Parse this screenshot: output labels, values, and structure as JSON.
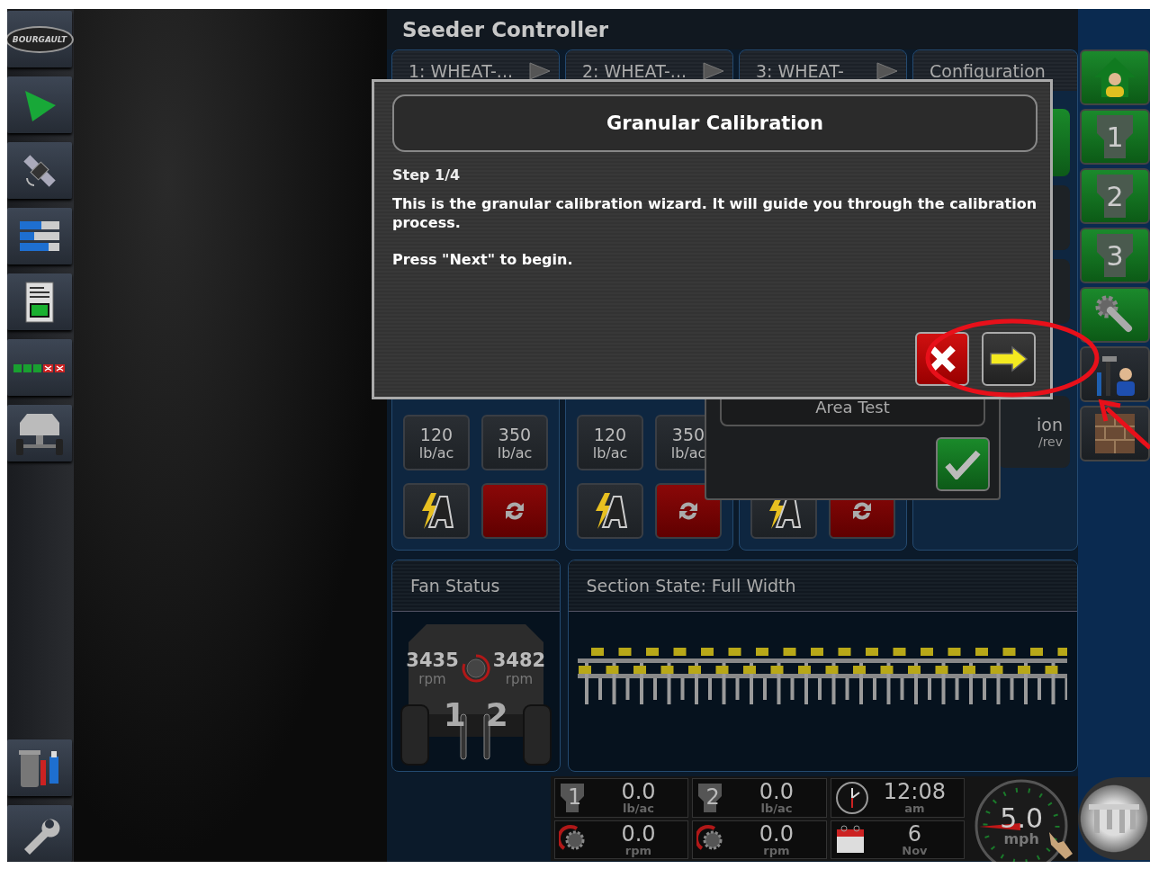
{
  "title": "Seeder Controller",
  "logo": "BOURGAULT",
  "products": [
    {
      "tab": "1: WHEAT-...",
      "presets": [
        {
          "value": "120",
          "unit": "lb/ac"
        },
        {
          "value": "350",
          "unit": "lb/ac"
        }
      ]
    },
    {
      "tab": "2: WHEAT-...",
      "presets": [
        {
          "value": "120",
          "unit": "lb/ac"
        },
        {
          "value": "350",
          "unit": "lb/ac"
        }
      ]
    },
    {
      "tab": "3: WHEAT-"
    }
  ],
  "configuration": {
    "tab": "Configuration",
    "label": "ion",
    "unit": "/rev"
  },
  "calibration_panel": {
    "buttons": [
      {
        "label": "Area Test"
      }
    ]
  },
  "dialog": {
    "title": "Granular Calibration",
    "step": "Step 1/4",
    "message": "This is the granular calibration wizard. It will guide you through the calibration process.",
    "instruction": "Press \"Next\" to begin."
  },
  "right_bar": [
    {
      "kind": "home",
      "active": true
    },
    {
      "kind": "product",
      "label": "1",
      "active": true
    },
    {
      "kind": "product",
      "label": "2",
      "active": true
    },
    {
      "kind": "product",
      "label": "3",
      "active": true
    },
    {
      "kind": "settings",
      "active": true
    },
    {
      "kind": "tools",
      "active": false
    },
    {
      "kind": "layout",
      "active": false
    }
  ],
  "fan_status": {
    "title": "Fan Status",
    "fans": [
      {
        "value": "3435",
        "unit": "rpm"
      },
      {
        "value": "3482",
        "unit": "rpm"
      }
    ],
    "fan_labels": [
      "1",
      "2"
    ]
  },
  "section_state": {
    "title": "Section State: Full Width"
  },
  "status_bar": {
    "products": [
      {
        "label": "1",
        "rate": "0.0",
        "rate_unit": "lb/ac",
        "fan": "0.0",
        "fan_unit": "rpm"
      },
      {
        "label": "2",
        "rate": "0.0",
        "rate_unit": "lb/ac",
        "fan": "0.0",
        "fan_unit": "rpm"
      }
    ],
    "time": "12:08",
    "ampm": "am",
    "day": "6",
    "month": "Nov",
    "speed": "5.0",
    "speed_unit": "mph"
  }
}
